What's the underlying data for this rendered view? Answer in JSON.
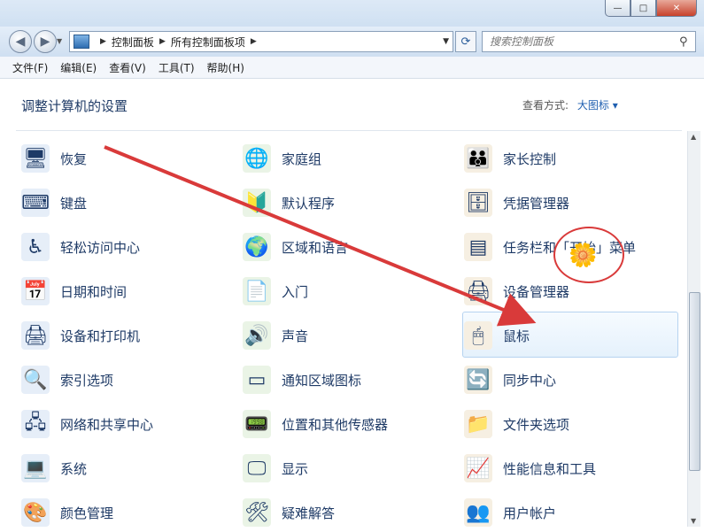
{
  "window": {
    "minimize": "—",
    "maximize": "□",
    "close": "✕"
  },
  "address": {
    "crumbs": [
      "控制面板",
      "所有控制面板项"
    ]
  },
  "search": {
    "placeholder": "搜索控制面板"
  },
  "menu": [
    "文件(F)",
    "编辑(E)",
    "查看(V)",
    "工具(T)",
    "帮助(H)"
  ],
  "header": {
    "title": "调整计算机的设置",
    "view_label": "查看方式:",
    "view_value": "大图标 ▾"
  },
  "items": [
    {
      "label": "恢复",
      "icon": "recovery-icon"
    },
    {
      "label": "家庭组",
      "icon": "homegroup-icon"
    },
    {
      "label": "家长控制",
      "icon": "parental-control-icon"
    },
    {
      "label": "键盘",
      "icon": "keyboard-icon"
    },
    {
      "label": "默认程序",
      "icon": "default-programs-icon"
    },
    {
      "label": "凭据管理器",
      "icon": "credential-manager-icon"
    },
    {
      "label": "轻松访问中心",
      "icon": "ease-of-access-icon"
    },
    {
      "label": "区域和语言",
      "icon": "region-language-icon"
    },
    {
      "label": "任务栏和「开始」菜单",
      "icon": "taskbar-icon"
    },
    {
      "label": "日期和时间",
      "icon": "date-time-icon"
    },
    {
      "label": "入门",
      "icon": "getting-started-icon"
    },
    {
      "label": "设备管理器",
      "icon": "device-manager-icon"
    },
    {
      "label": "设备和打印机",
      "icon": "devices-printers-icon"
    },
    {
      "label": "声音",
      "icon": "sound-icon"
    },
    {
      "label": "鼠标",
      "icon": "mouse-icon"
    },
    {
      "label": "索引选项",
      "icon": "indexing-icon"
    },
    {
      "label": "通知区域图标",
      "icon": "notification-area-icon"
    },
    {
      "label": "同步中心",
      "icon": "sync-center-icon"
    },
    {
      "label": "网络和共享中心",
      "icon": "network-icon"
    },
    {
      "label": "位置和其他传感器",
      "icon": "location-sensors-icon"
    },
    {
      "label": "文件夹选项",
      "icon": "folder-options-icon"
    },
    {
      "label": "系统",
      "icon": "system-icon"
    },
    {
      "label": "显示",
      "icon": "display-icon"
    },
    {
      "label": "性能信息和工具",
      "icon": "performance-icon"
    },
    {
      "label": "颜色管理",
      "icon": "color-management-icon"
    },
    {
      "label": "疑难解答",
      "icon": "troubleshooting-icon"
    },
    {
      "label": "用户帐户",
      "icon": "user-accounts-icon"
    }
  ],
  "colors": {
    "accent": "#1f5fb0",
    "annotation": "#d93a3a"
  }
}
